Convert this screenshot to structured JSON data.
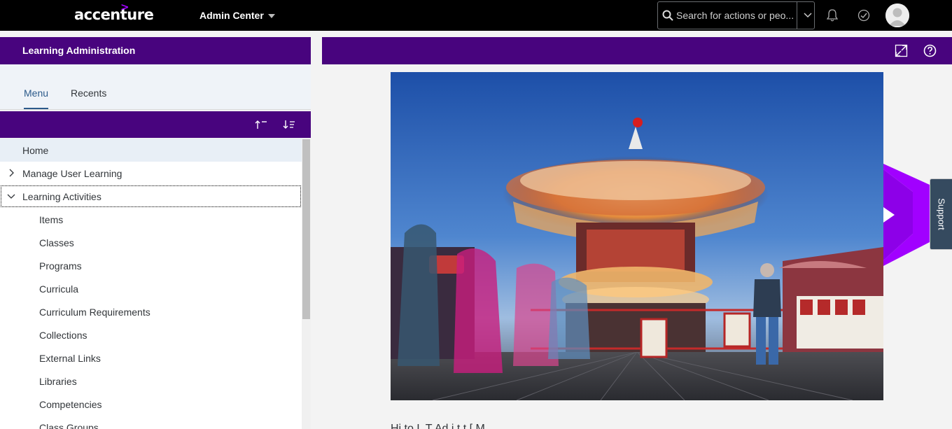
{
  "shell": {
    "logo": "accenture",
    "logo_mark": ">",
    "app_menu": "Admin Center",
    "search_placeholder": "Search for actions or peo...",
    "colors": {
      "bar": "#000000",
      "accent": "#a100ff"
    }
  },
  "left_panel": {
    "title": "Learning Administration",
    "tabs": [
      {
        "label": "Menu",
        "selected": true
      },
      {
        "label": "Recents",
        "selected": false
      }
    ],
    "sort_icons": [
      "sort-ascending-icon",
      "sort-descending-icon"
    ],
    "tree": [
      {
        "label": "Home",
        "level": 0,
        "expandable": false,
        "selected": true
      },
      {
        "label": "Manage User Learning",
        "level": 0,
        "expandable": true,
        "expanded": false
      },
      {
        "label": "Learning Activities",
        "level": 0,
        "expandable": true,
        "expanded": true
      },
      {
        "label": "Items",
        "level": 1
      },
      {
        "label": "Classes",
        "level": 1
      },
      {
        "label": "Programs",
        "level": 1
      },
      {
        "label": "Curricula",
        "level": 1
      },
      {
        "label": "Curriculum Requirements",
        "level": 1
      },
      {
        "label": "Collections",
        "level": 1
      },
      {
        "label": "External Links",
        "level": 1
      },
      {
        "label": "Libraries",
        "level": 1
      },
      {
        "label": "Competencies",
        "level": 1
      },
      {
        "label": "Class Groups",
        "level": 1
      }
    ]
  },
  "right_panel": {
    "header_icons": [
      "fullscreen-icon",
      "help-icon"
    ],
    "image_alt": "Carousel at night with motion blur",
    "support_label": "Support",
    "body_text_partial": "Hi                              to  L       T      Ad    i  t  t     [   M                     "
  },
  "colors": {
    "header": "#48047e",
    "tree_selected": "#e8eff6"
  }
}
